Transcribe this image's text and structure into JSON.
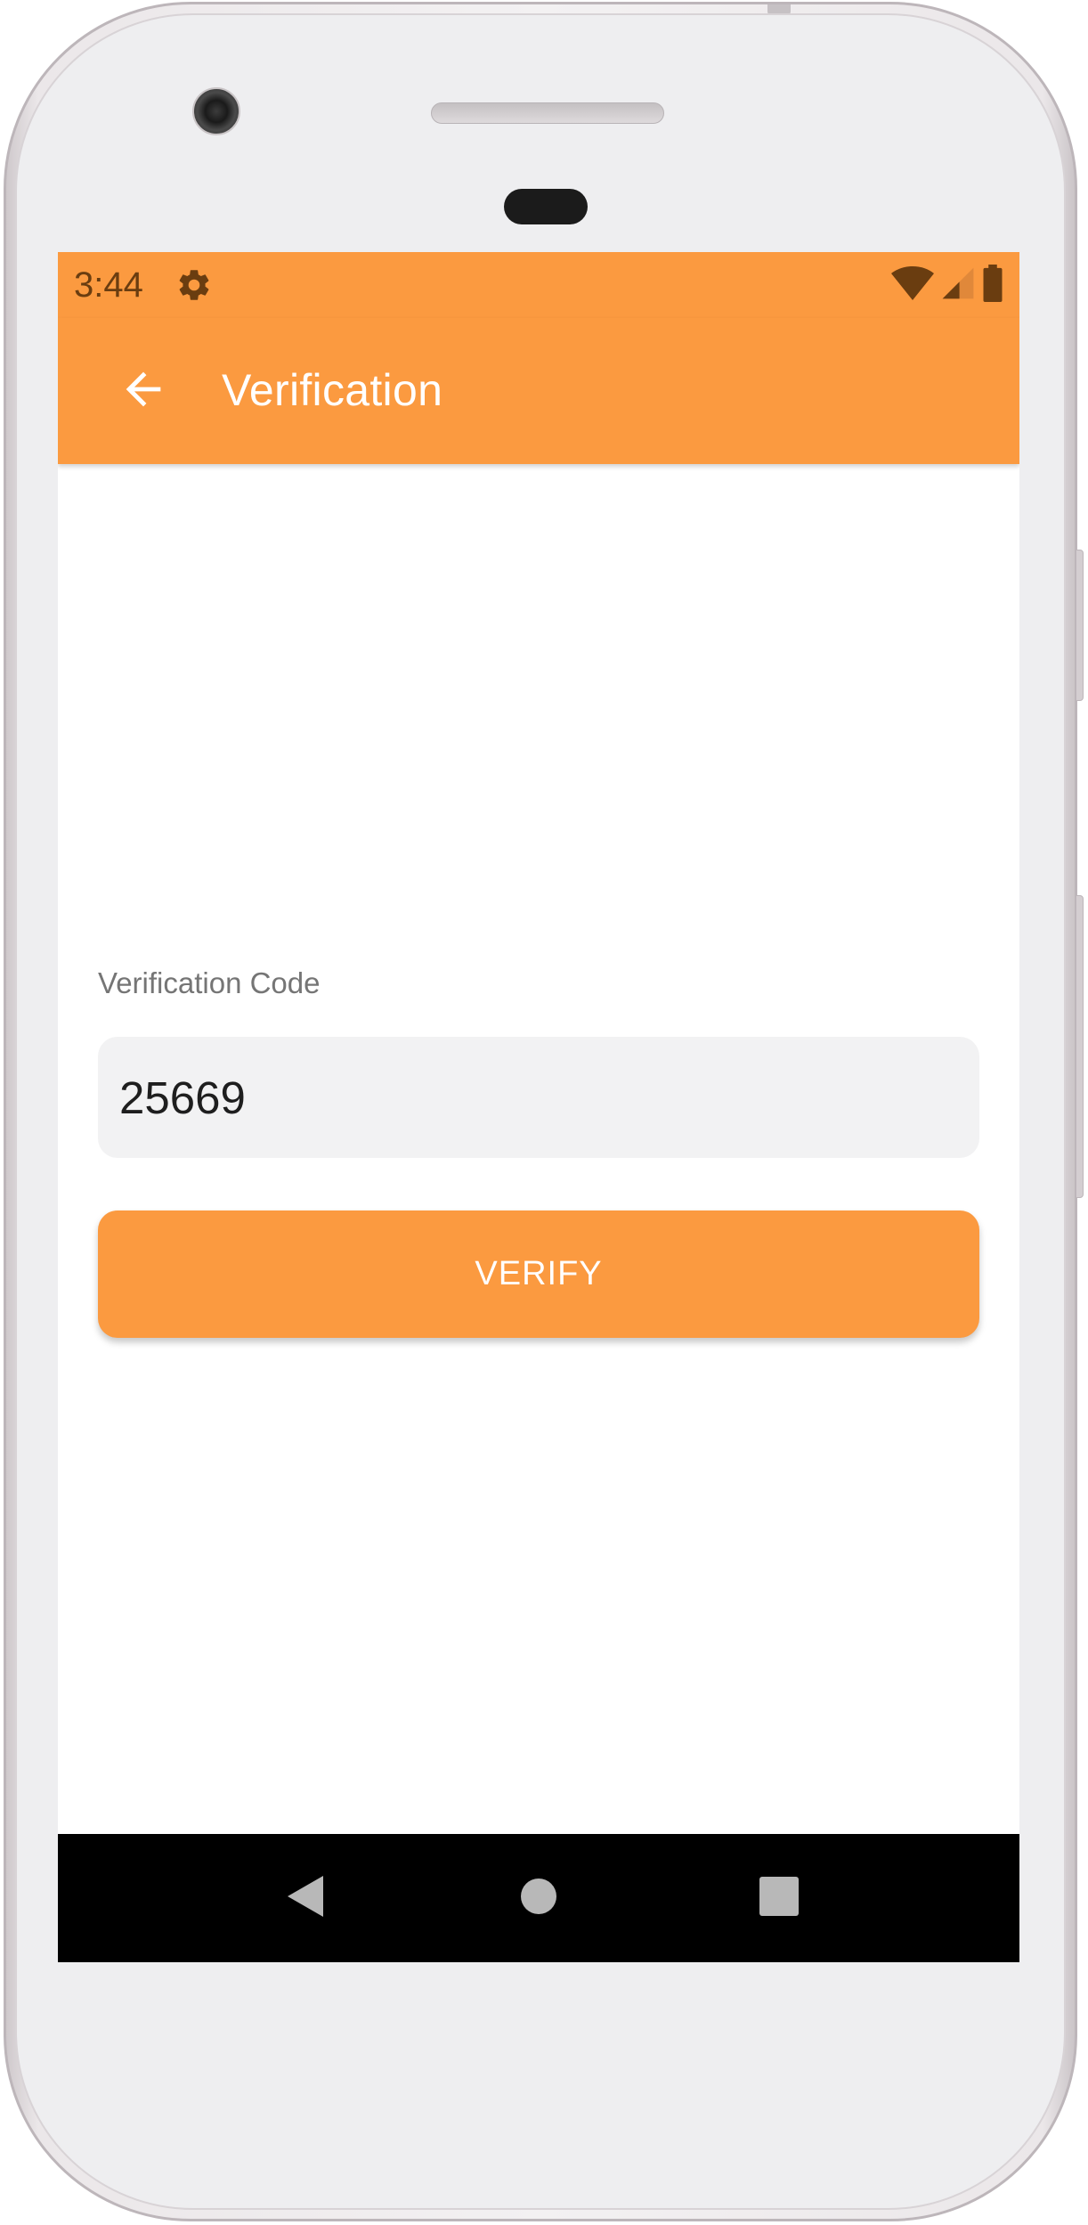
{
  "status_bar": {
    "time": "3:44",
    "icons": [
      "gear-icon",
      "wifi-icon",
      "signal-icon",
      "battery-icon"
    ]
  },
  "app_bar": {
    "back_icon": "arrow-back-icon",
    "title": "Verification"
  },
  "form": {
    "label": "Verification Code",
    "code_value": "25669",
    "button_label": "VERIFY"
  },
  "nav_bar": {
    "icons": [
      "back-triangle-icon",
      "home-circle-icon",
      "recents-square-icon"
    ]
  },
  "colors": {
    "accent": "#fb9a40",
    "status_icon": "#6a3d10",
    "input_bg": "#f2f2f3",
    "label": "#757575"
  }
}
